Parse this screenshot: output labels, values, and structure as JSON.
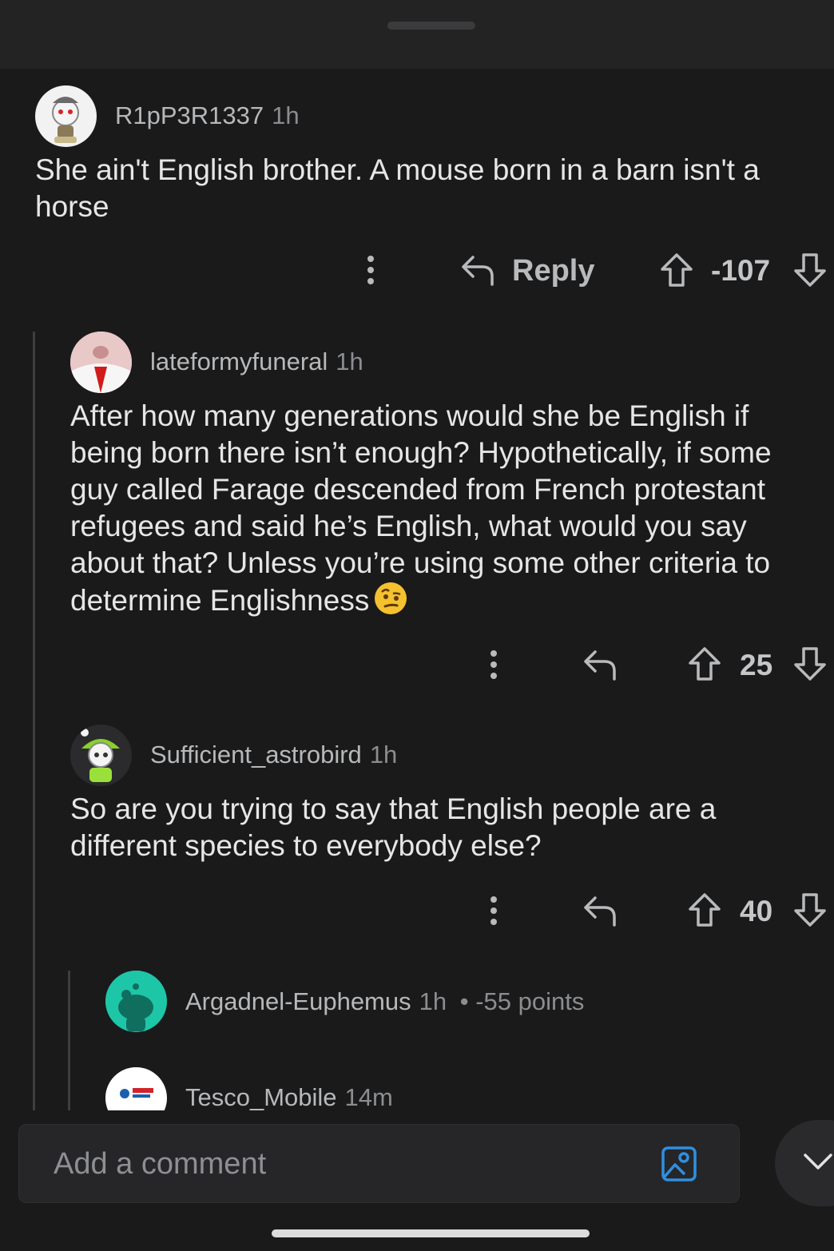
{
  "sheet": {
    "handle": ""
  },
  "comments": [
    {
      "username": "R1pP3R1337",
      "time": "1h",
      "text": "She ain't English brother. A mouse born in a barn isn't a horse",
      "reply_label": "Reply",
      "score": "-107"
    },
    {
      "username": "lateformyfuneral",
      "time": "1h",
      "text": "After how many generations would she be English if being born there isn’t enough? Hypothetically, if some guy called Farage descended from French protestant refugees and said he’s English, what would you say about that? Unless you’re using some other criteria to determine Englishness",
      "emoji": "face-with-raised-eyebrow",
      "score": "25"
    },
    {
      "username": "Sufficient_astrobird",
      "time": "1h",
      "text": "So are you trying to say that English people are a different species to everybody else?",
      "score": "40"
    },
    {
      "username": "Argadnel-Euphemus",
      "time": "1h",
      "meta": "• -55 points",
      "collapsed": true
    },
    {
      "username": "Tesco_Mobile",
      "time": "14m",
      "avatar_text": "tesco mobile"
    }
  ],
  "composer": {
    "placeholder": "Add a comment",
    "icon": "image-icon"
  },
  "fab": {
    "icon": "chevron-down-icon"
  },
  "colors": {
    "background": "#1a1a1b",
    "accent_blue": "#2f8fe0",
    "avatar_teal": "#1ec6a8"
  }
}
